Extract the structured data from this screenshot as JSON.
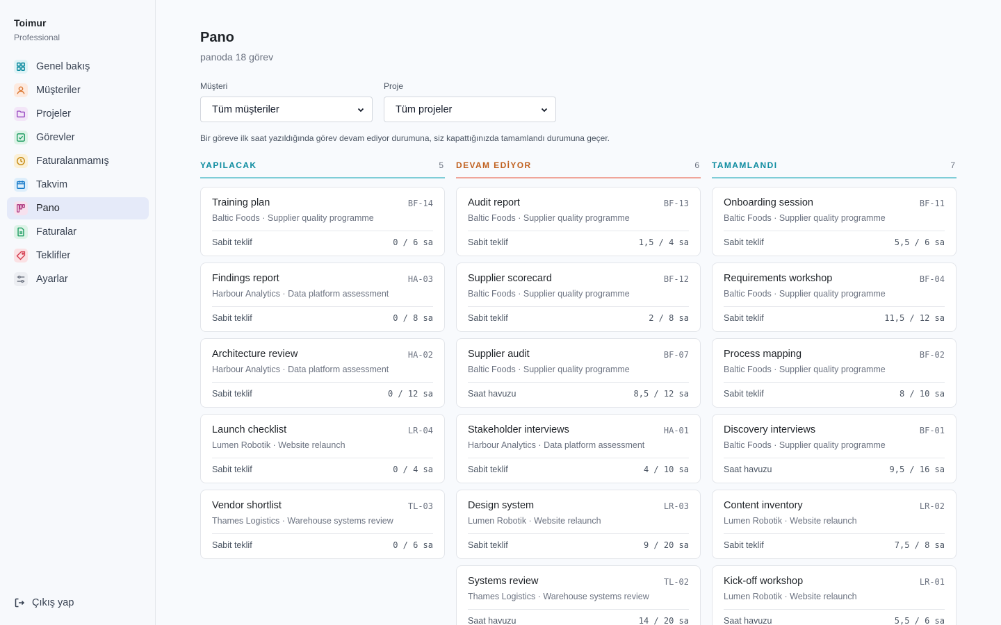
{
  "sidebar": {
    "brand_name": "Toimur",
    "brand_plan": "Professional",
    "items": [
      {
        "label": "Genel bakış",
        "icon": "grid-icon",
        "color": "#0e8ca0",
        "bg": "#dff3f6"
      },
      {
        "label": "Müşteriler",
        "icon": "user-icon",
        "color": "#d9722b",
        "bg": "#fdeadf"
      },
      {
        "label": "Projeler",
        "icon": "folder-icon",
        "color": "#9b4fc2",
        "bg": "#f3e6f8"
      },
      {
        "label": "Görevler",
        "icon": "check-square-icon",
        "color": "#1f9d63",
        "bg": "#ddf3e7"
      },
      {
        "label": "Faturalanmamış",
        "icon": "clock-icon",
        "color": "#c58a12",
        "bg": "#fbf0d6"
      },
      {
        "label": "Takvim",
        "icon": "calendar-icon",
        "color": "#1479c9",
        "bg": "#ddeefb"
      },
      {
        "label": "Pano",
        "icon": "kanban-icon",
        "color": "#b13f85",
        "bg": "#f7e1ee"
      },
      {
        "label": "Faturalar",
        "icon": "document-icon",
        "color": "#1f9d63",
        "bg": "#ddf3e7"
      },
      {
        "label": "Teklifler",
        "icon": "tag-icon",
        "color": "#d43d4f",
        "bg": "#fbe1e4"
      },
      {
        "label": "Ayarlar",
        "icon": "sliders-icon",
        "color": "#6b7280",
        "bg": "#eceef2"
      }
    ],
    "logout_label": "Çıkış yap"
  },
  "header": {
    "title": "Pano",
    "subtitle": "panoda 18 görev"
  },
  "filters": {
    "client_label": "Müşteri",
    "client_value": "Tüm müşteriler",
    "project_label": "Proje",
    "project_value": "Tüm projeler"
  },
  "hint": "Bir göreve ilk saat yazıldığında görev devam ediyor durumuna, siz kapattığınızda tamamlandı durumuna geçer.",
  "colors": {
    "todo": "#0e8ca0",
    "todo_line": "#7fcdd7",
    "in_progress": "#c0601e",
    "in_progress_line": "#f0a59a",
    "done": "#0e8ca0",
    "done_line": "#7fcdd7"
  },
  "columns": [
    {
      "title": "YAPILACAK",
      "count": "5",
      "cards": [
        {
          "title": "Training plan",
          "id": "BF-14",
          "sub": "Baltic Foods · Supplier quality programme",
          "type": "Sabit teklif",
          "hours": "0 / 6 sa"
        },
        {
          "title": "Findings report",
          "id": "HA-03",
          "sub": "Harbour Analytics · Data platform assessment",
          "type": "Sabit teklif",
          "hours": "0 / 8 sa"
        },
        {
          "title": "Architecture review",
          "id": "HA-02",
          "sub": "Harbour Analytics · Data platform assessment",
          "type": "Sabit teklif",
          "hours": "0 / 12 sa"
        },
        {
          "title": "Launch checklist",
          "id": "LR-04",
          "sub": "Lumen Robotik · Website relaunch",
          "type": "Sabit teklif",
          "hours": "0 / 4 sa"
        },
        {
          "title": "Vendor shortlist",
          "id": "TL-03",
          "sub": "Thames Logistics · Warehouse systems review",
          "type": "Sabit teklif",
          "hours": "0 / 6 sa"
        }
      ]
    },
    {
      "title": "DEVAM EDİYOR",
      "count": "6",
      "cards": [
        {
          "title": "Audit report",
          "id": "BF-13",
          "sub": "Baltic Foods · Supplier quality programme",
          "type": "Sabit teklif",
          "hours": "1,5 / 4 sa"
        },
        {
          "title": "Supplier scorecard",
          "id": "BF-12",
          "sub": "Baltic Foods · Supplier quality programme",
          "type": "Sabit teklif",
          "hours": "2 / 8 sa"
        },
        {
          "title": "Supplier audit",
          "id": "BF-07",
          "sub": "Baltic Foods · Supplier quality programme",
          "type": "Saat havuzu",
          "hours": "8,5 / 12 sa"
        },
        {
          "title": "Stakeholder interviews",
          "id": "HA-01",
          "sub": "Harbour Analytics · Data platform assessment",
          "type": "Sabit teklif",
          "hours": "4 / 10 sa"
        },
        {
          "title": "Design system",
          "id": "LR-03",
          "sub": "Lumen Robotik · Website relaunch",
          "type": "Sabit teklif",
          "hours": "9 / 20 sa"
        },
        {
          "title": "Systems review",
          "id": "TL-02",
          "sub": "Thames Logistics · Warehouse systems review",
          "type": "Saat havuzu",
          "hours": "14 / 20 sa"
        }
      ]
    },
    {
      "title": "TAMAMLANDI",
      "count": "7",
      "cards": [
        {
          "title": "Onboarding session",
          "id": "BF-11",
          "sub": "Baltic Foods · Supplier quality programme",
          "type": "Sabit teklif",
          "hours": "5,5 / 6 sa"
        },
        {
          "title": "Requirements workshop",
          "id": "BF-04",
          "sub": "Baltic Foods · Supplier quality programme",
          "type": "Sabit teklif",
          "hours": "11,5 / 12 sa"
        },
        {
          "title": "Process mapping",
          "id": "BF-02",
          "sub": "Baltic Foods · Supplier quality programme",
          "type": "Sabit teklif",
          "hours": "8 / 10 sa"
        },
        {
          "title": "Discovery interviews",
          "id": "BF-01",
          "sub": "Baltic Foods · Supplier quality programme",
          "type": "Saat havuzu",
          "hours": "9,5 / 16 sa"
        },
        {
          "title": "Content inventory",
          "id": "LR-02",
          "sub": "Lumen Robotik · Website relaunch",
          "type": "Sabit teklif",
          "hours": "7,5 / 8 sa"
        },
        {
          "title": "Kick-off workshop",
          "id": "LR-01",
          "sub": "Lumen Robotik · Website relaunch",
          "type": "Saat havuzu",
          "hours": "5,5 / 6 sa"
        }
      ]
    }
  ]
}
